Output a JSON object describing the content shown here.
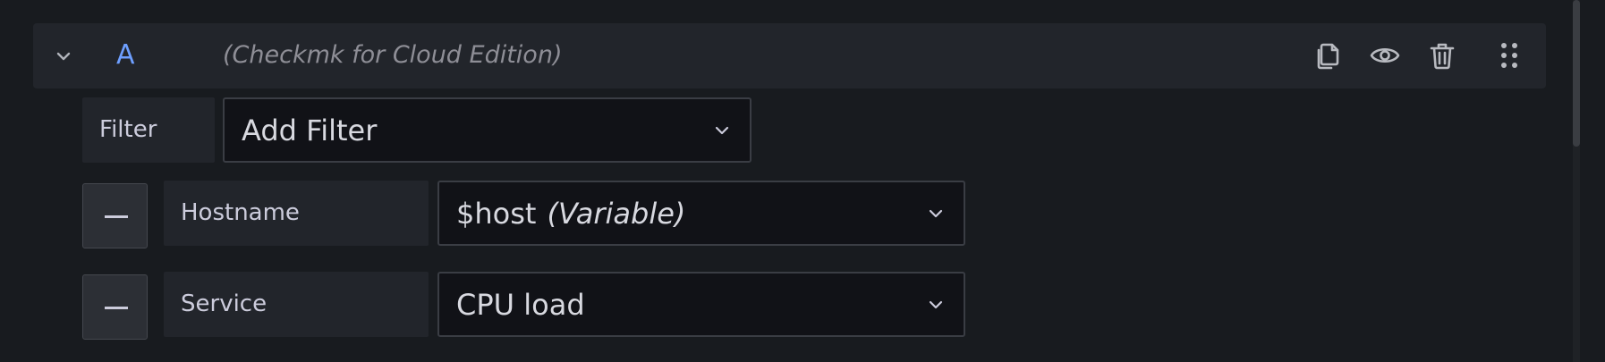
{
  "query": {
    "ref_id": "A",
    "datasource": "(Checkmk for Cloud Edition)",
    "icons": [
      "chevron-down-icon",
      "duplicate-icon",
      "eye-icon",
      "trash-icon",
      "drag-handle-icon"
    ]
  },
  "filter": {
    "label": "Filter",
    "placeholder": "Add Filter"
  },
  "filters": [
    {
      "label": "Hostname",
      "value": "$host",
      "suffix": "(Variable)"
    },
    {
      "label": "Service",
      "value": "CPU load",
      "suffix": ""
    }
  ],
  "colors": {
    "background": "#181b1f",
    "panel": "#22252b",
    "accent": "#6e9fff",
    "input_bg": "#111217"
  }
}
